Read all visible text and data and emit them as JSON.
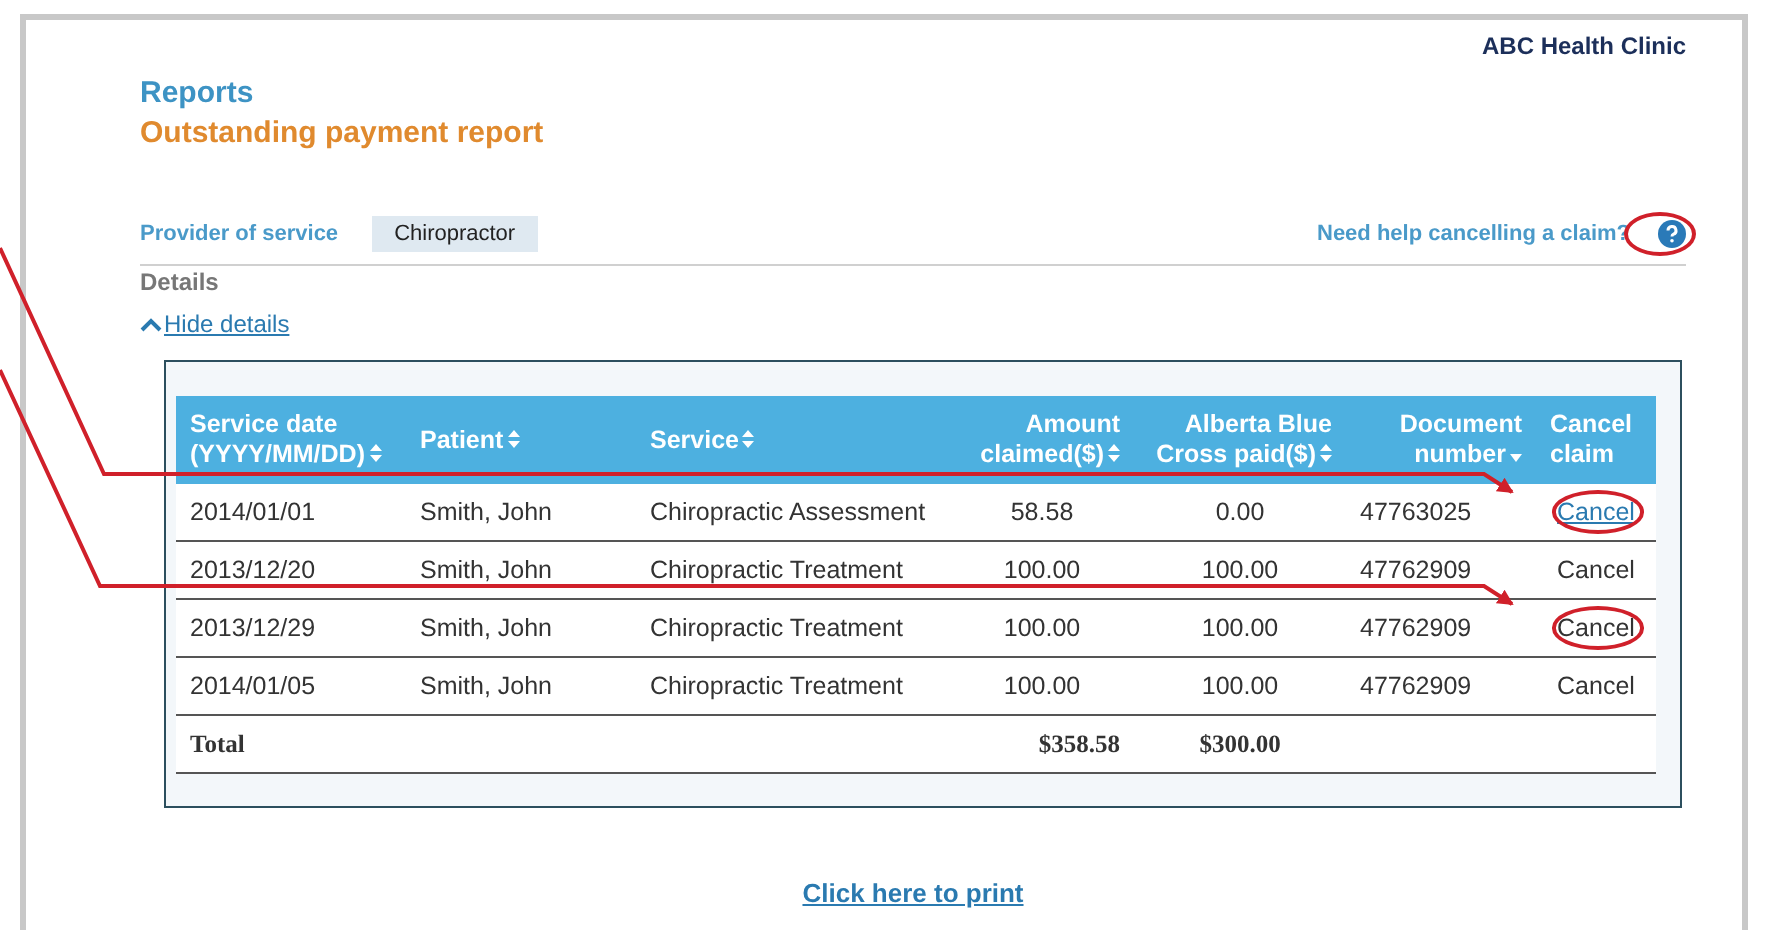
{
  "clinic": "ABC Health Clinic",
  "section": "Reports",
  "title": "Outstanding payment report",
  "provider": {
    "label": "Provider of service",
    "value": "Chiropractor"
  },
  "help": {
    "text": "Need help cancelling a claim?",
    "circled": true
  },
  "details": {
    "heading": "Details",
    "toggle": "Hide details",
    "expanded": true
  },
  "table": {
    "columns": [
      {
        "label": "Service date (YYYY/MM/DD)",
        "sortable": true
      },
      {
        "label": "Patient",
        "sortable": true
      },
      {
        "label": "Service",
        "sortable": true
      },
      {
        "label": "Amount claimed($)",
        "sortable": true
      },
      {
        "label": "Alberta Blue Cross paid($)",
        "sortable": true
      },
      {
        "label": "Document number",
        "sortable": true,
        "sorted_descending": true
      },
      {
        "label": "Cancel claim",
        "sortable": false
      }
    ],
    "rows": [
      {
        "cells": [
          "2014/01/01",
          "Smith, John",
          "Chiropractic Assessment",
          "58.58",
          "0.00",
          "47763025"
        ],
        "cancel": {
          "text": "Cancel",
          "kind": "link",
          "circled": true
        }
      },
      {
        "cells": [
          "2013/12/20",
          "Smith, John",
          "Chiropractic Treatment",
          "100.00",
          "100.00",
          "47762909"
        ],
        "cancel": {
          "text": "Cancel",
          "kind": "text",
          "circled": false
        }
      },
      {
        "cells": [
          "2013/12/29",
          "Smith, John",
          "Chiropractic Treatment",
          "100.00",
          "100.00",
          "47762909"
        ],
        "cancel": {
          "text": "Cancel",
          "kind": "text",
          "circled": true
        }
      },
      {
        "cells": [
          "2014/01/05",
          "Smith, John",
          "Chiropractic Treatment",
          "100.00",
          "100.00",
          "47762909"
        ],
        "cancel": {
          "text": "Cancel",
          "kind": "text",
          "circled": false
        }
      }
    ],
    "total": {
      "label": "Total",
      "amount": "$358.58",
      "paid": "$300.00"
    }
  },
  "print": "Click here to print"
}
